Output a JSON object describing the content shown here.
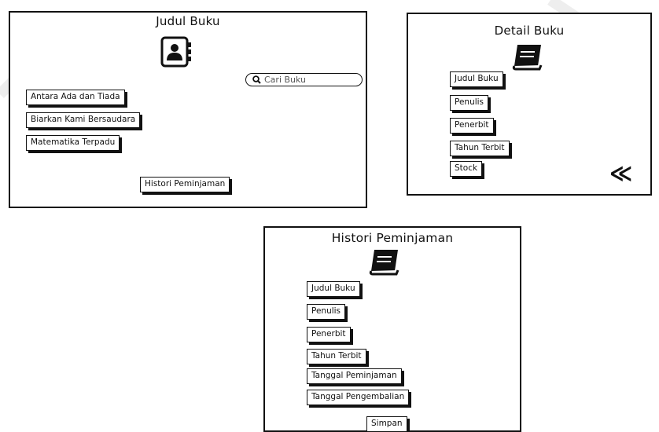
{
  "panel_list": {
    "title": "Judul Buku",
    "search_placeholder": "Cari Buku",
    "books": [
      "Antara Ada dan Tiada",
      "Biarkan Kami Bersaudara",
      "Matematika Terpadu"
    ],
    "history_button": "Histori Peminjaman",
    "icon": "contact-book-icon"
  },
  "panel_detail": {
    "title": "Detail Buku",
    "icon": "book-icon",
    "fields": [
      "Judul Buku",
      "Penulis",
      "Penerbit",
      "Tahun Terbit",
      "Stock"
    ],
    "back_icon": "double-chevron-left-icon",
    "back_glyph": "≪"
  },
  "panel_history": {
    "title": "Histori Peminjaman",
    "icon": "book-icon",
    "fields": [
      "Judul Buku",
      "Penulis",
      "Penerbit",
      "Tahun Terbit",
      "Tanggal Peminjaman",
      "Tanggal Pengembalian"
    ],
    "save_button": "Simpan"
  }
}
